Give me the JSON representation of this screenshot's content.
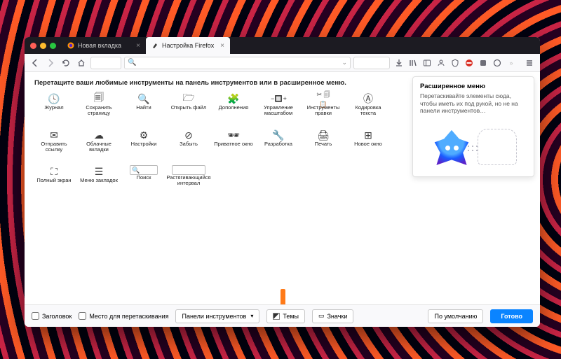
{
  "tabs": [
    {
      "label": "Новая вкладка",
      "active": false
    },
    {
      "label": "Настройка Firefox",
      "active": true
    }
  ],
  "toolbar_icons": [
    "download-icon",
    "library-icon",
    "sidebar-icon",
    "account-icon",
    "shield-icon",
    "adblock-icon",
    "extension-icon",
    "extension2-icon",
    "overflow-icon"
  ],
  "instruction": "Перетащите ваши любимые инструменты на панель инструментов или в расширенное меню.",
  "tools": [
    {
      "icon": "🕓",
      "label": "Журнал"
    },
    {
      "icon": "🗐",
      "label": "Сохранить страницу"
    },
    {
      "icon": "🔍",
      "label": "Найти"
    },
    {
      "icon": "🗁",
      "label": "Открыть файл"
    },
    {
      "icon": "🧩",
      "label": "Дополнения"
    },
    {
      "icon": "⤢",
      "label": "Управление масштабом"
    },
    {
      "icon": "✂",
      "label": "Инструменты правки"
    },
    {
      "icon": "Ⓐ",
      "label": "Кодировка текста"
    },
    {
      "icon": "✉",
      "label": "Отправить ссылку"
    },
    {
      "icon": "☁",
      "label": "Облачные вкладки"
    },
    {
      "icon": "⚙",
      "label": "Настройки"
    },
    {
      "icon": "⊘",
      "label": "Забыть"
    },
    {
      "icon": "🕶",
      "label": "Приватное окно"
    },
    {
      "icon": "🔧",
      "label": "Разработка"
    },
    {
      "icon": "🖨",
      "label": "Печать"
    },
    {
      "icon": "⊞",
      "label": "Новое окно"
    },
    {
      "icon": "⛶",
      "label": "Полный экран"
    },
    {
      "icon": "☰",
      "label": "Меню закладок"
    },
    {
      "icon": "search",
      "label": "Поиск"
    },
    {
      "icon": "spacer",
      "label": "Растягивающийся интервал"
    }
  ],
  "panel": {
    "title": "Расширенное меню",
    "body": "Перетаскивайте элементы сюда, чтобы иметь их под рукой, но не на панели инструментов…"
  },
  "footer": {
    "title_checkbox": "Заголовок",
    "dragspace_checkbox": "Место для перетаскивания",
    "toolbars_btn": "Панели инструментов",
    "themes_btn": "Темы",
    "density_btn": "Значки",
    "restore_btn": "По умолчанию",
    "done_btn": "Готово"
  }
}
